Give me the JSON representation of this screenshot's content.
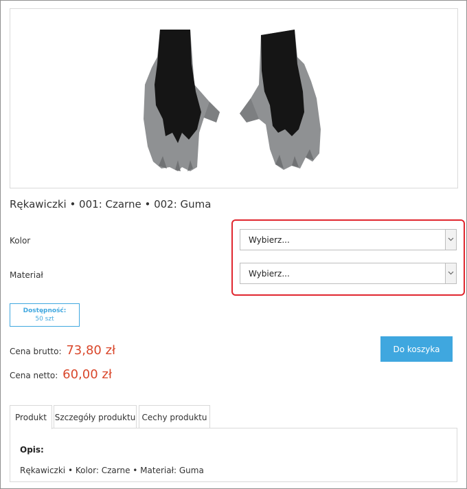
{
  "product": {
    "title": "Rękawiczki • 001: Czarne • 002: Guma",
    "image_icon": "gloves-image"
  },
  "options": {
    "color_label": "Kolor",
    "color_value": "Wybierz...",
    "material_label": "Materiał",
    "material_value": "Wybierz..."
  },
  "availability": {
    "label": "Dostępność:",
    "value": "50 szt"
  },
  "prices": {
    "gross_label": "Cena brutto:",
    "gross_value": "73,80 zł",
    "net_label": "Cena netto:",
    "net_value": "60,00 zł"
  },
  "cart": {
    "button_label": "Do koszyka"
  },
  "tabs": [
    {
      "label": "Produkt"
    },
    {
      "label": "Szczegóły produktu"
    },
    {
      "label": "Cechy produktu"
    }
  ],
  "panel": {
    "heading": "Opis:",
    "text": "Rękawiczki • Kolor: Czarne • Materiał: Guma"
  },
  "colors": {
    "accent": "#3fa7df",
    "price": "#d9472b",
    "highlight": "#e0262e"
  }
}
